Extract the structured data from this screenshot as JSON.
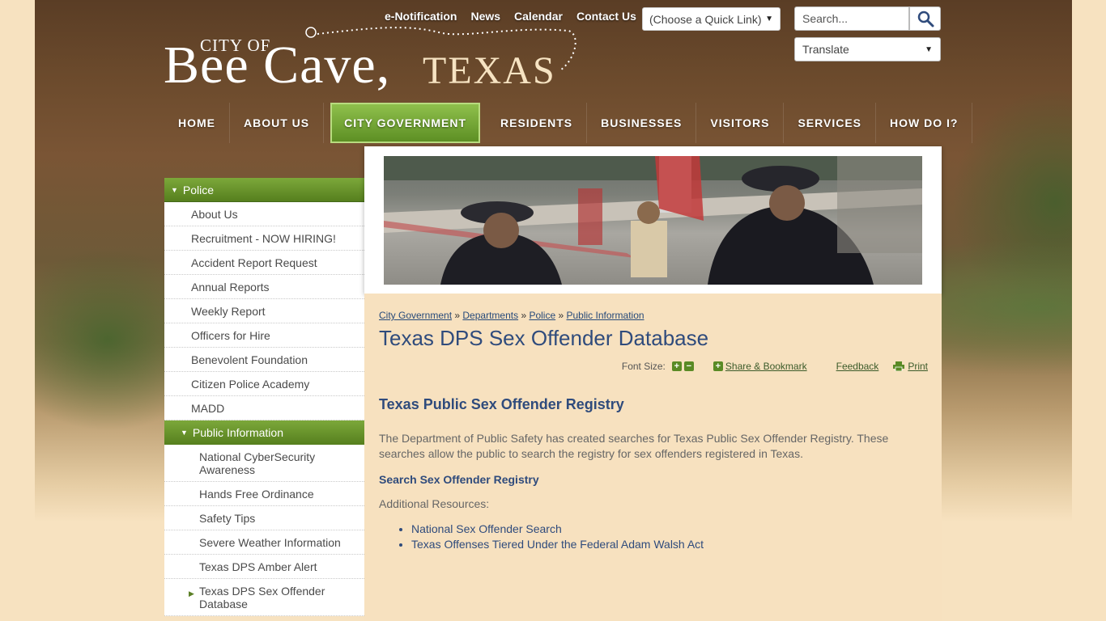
{
  "top_links": [
    "e-Notification",
    "News",
    "Calendar",
    "Contact Us"
  ],
  "quick_link": {
    "selected": "(Choose a Quick Link)"
  },
  "search": {
    "placeholder": "Search..."
  },
  "translate": {
    "selected": "Translate"
  },
  "logo": {
    "city_of": "CITY OF",
    "bee_cave": "Bee Cave,",
    "texas": "TEXAS"
  },
  "nav": [
    "HOME",
    "ABOUT US",
    "CITY GOVERNMENT",
    "RESIDENTS",
    "BUSINESSES",
    "VISITORS",
    "SERVICES",
    "HOW DO I?"
  ],
  "nav_active": "CITY GOVERNMENT",
  "sidebar": {
    "heading": "Police",
    "items": [
      "About Us",
      "Recruitment - NOW HIRING!",
      "Accident Report Request",
      "Annual Reports",
      "Weekly Report",
      "Officers for Hire",
      "Benevolent Foundation",
      "Citizen Police Academy",
      "MADD"
    ],
    "sub_heading": "Public Information",
    "sub_items": [
      "National CyberSecurity Awareness",
      "Hands Free Ordinance",
      "Safety Tips",
      "Severe Weather Information",
      "Texas DPS Amber Alert",
      "Texas DPS Sex Offender Database"
    ]
  },
  "breadcrumb": [
    "City Government",
    "Departments",
    "Police",
    "Public Information"
  ],
  "page_title": "Texas DPS Sex Offender Database",
  "tools": {
    "font_size": "Font Size:",
    "share": "Share & Bookmark",
    "feedback": "Feedback",
    "print": "Print"
  },
  "content": {
    "heading": "Texas Public Sex Offender Registry",
    "paragraph": "The Department of Public Safety has created searches for Texas Public Sex Offender Registry. These searches allow the public to search the registry for sex offenders registered in Texas.",
    "search_link": "Search Sex Offender Registry",
    "additional": "Additional Resources:",
    "resources": [
      "National Sex Offender Search",
      "Texas Offenses Tiered Under the Federal Adam Walsh Act"
    ]
  },
  "colors": {
    "nav_active": "#6a9f2c",
    "title": "#2f4b7c",
    "sidebar_head": "#6a9630"
  }
}
